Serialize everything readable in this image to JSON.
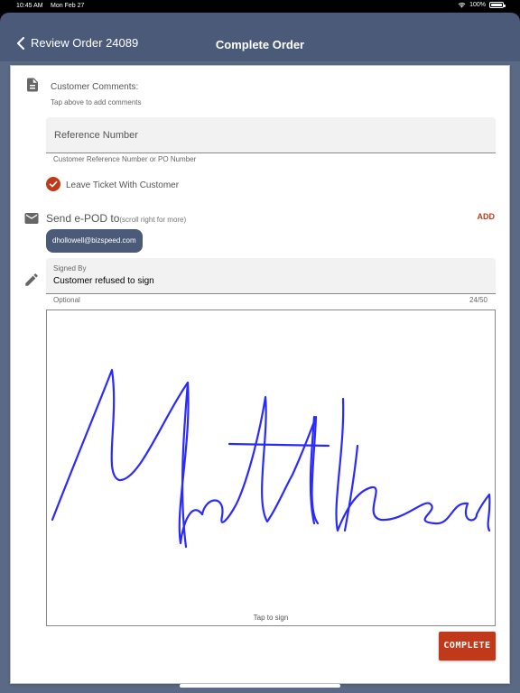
{
  "status_bar": {
    "time": "10:45 AM",
    "date": "Mon Feb 27",
    "battery": "100%"
  },
  "nav": {
    "back_label": "Review Order 24089",
    "title": "Complete Order"
  },
  "comments": {
    "title": "Customer Comments:",
    "hint": "Tap above to add comments"
  },
  "reference": {
    "placeholder": "Reference Number",
    "value": "",
    "helper": "Customer Reference Number or PO Number"
  },
  "leave_ticket": {
    "label": "Leave Ticket With Customer",
    "checked": true
  },
  "epod": {
    "title": "Send e-POD to",
    "hint": "(scroll right for more)",
    "add_label": "ADD",
    "emails": [
      "dhollowell@bizspeed.com"
    ]
  },
  "signed_by": {
    "label": "Signed By",
    "value": "Customer refused to sign",
    "helper": "Optional",
    "counter": "24/50"
  },
  "signature": {
    "hint": "Tap to sign",
    "ink_color": "#2a2aff"
  },
  "complete_button": {
    "label": "COMPLETE",
    "color": "#c0391b"
  },
  "theme": {
    "nav_color": "#4a5a78",
    "accent": "#c0391b"
  }
}
